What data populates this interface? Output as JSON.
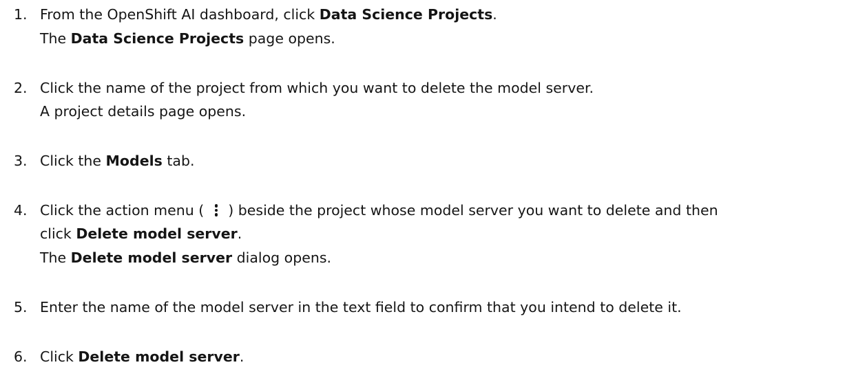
{
  "steps": [
    {
      "number": "1.",
      "line1": {
        "pre": "From the OpenShift AI dashboard, click ",
        "bold": "Data Science Projects",
        "post": "."
      },
      "line2": {
        "pre": "The ",
        "bold": "Data Science Projects",
        "post": " page opens."
      }
    },
    {
      "number": "2.",
      "line1": "Click the name of the project from which you want to delete the model server.",
      "line2": "A project details page opens."
    },
    {
      "number": "3.",
      "line1": {
        "pre": "Click the ",
        "bold": "Models",
        "post": " tab."
      }
    },
    {
      "number": "4.",
      "line1": {
        "pre": "Click the action menu ( ",
        "icon": "kebab-menu-icon",
        "post": " ) beside the project whose model server you want to delete and then"
      },
      "line2": {
        "pre": "click ",
        "bold": "Delete model server",
        "post": "."
      },
      "line3": {
        "pre": "The ",
        "bold": "Delete model server",
        "post": " dialog opens."
      }
    },
    {
      "number": "5.",
      "line1": "Enter the name of the model server in the text field to confirm that you intend to delete it."
    },
    {
      "number": "6.",
      "line1": {
        "pre": "Click ",
        "bold": "Delete model server",
        "post": "."
      }
    }
  ]
}
